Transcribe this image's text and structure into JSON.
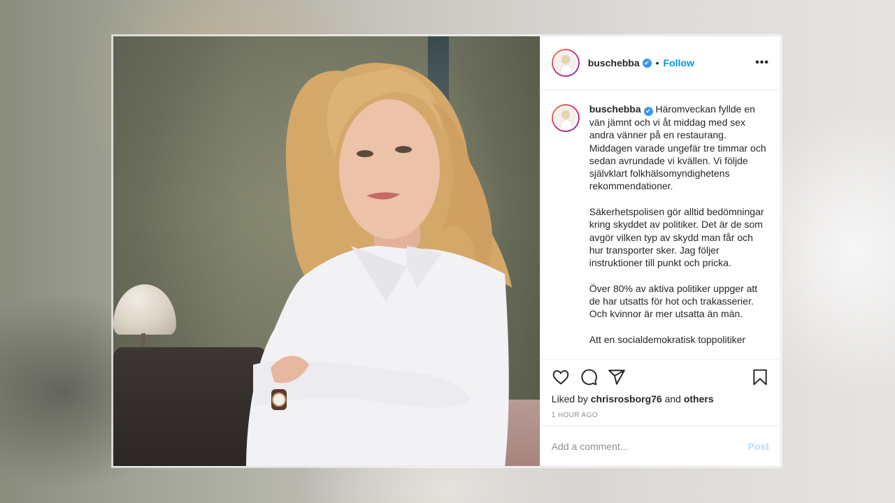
{
  "post": {
    "username": "buschebba",
    "verified_icon": "✔",
    "follow_label": "Follow",
    "separator": "•",
    "more_label": "•••",
    "caption_text": "Häromveckan fyllde en vän jämnt och vi åt middag med sex andra vänner på en restaurang. Middagen varade ungefär tre timmar och sedan avrundade vi kvällen. Vi följde självklart folkhälsomyndighetens rekommendationer.\n\nSäkerhetspolisen gör alltid bedömningar kring skyddet av politiker. Det är de som avgör vilken typ av skydd man får och hur transporter sker. Jag följer instruktioner till punkt och pricka.\n\nÖver 80% av aktiva politiker uppger att de har utsatts för hot och trakasserier. Och kvinnor är mer utsatta än män.\n\nAtt en socialdemokratisk toppolitiker",
    "liked_by_prefix": "Liked by",
    "liked_by_user": "chrisrosborg76",
    "liked_by_and": "and",
    "liked_by_others": "others",
    "timestamp": "1 HOUR AGO",
    "comment_placeholder": "Add a comment...",
    "post_label": "Post"
  },
  "icons": {
    "like": "heart-icon",
    "comment": "comment-icon",
    "share": "share-icon",
    "save": "bookmark-icon",
    "more": "more-options-icon"
  },
  "colors": {
    "link_blue": "#0095f6",
    "post_disabled": "#b3dbff",
    "verified": "#3897f0"
  }
}
